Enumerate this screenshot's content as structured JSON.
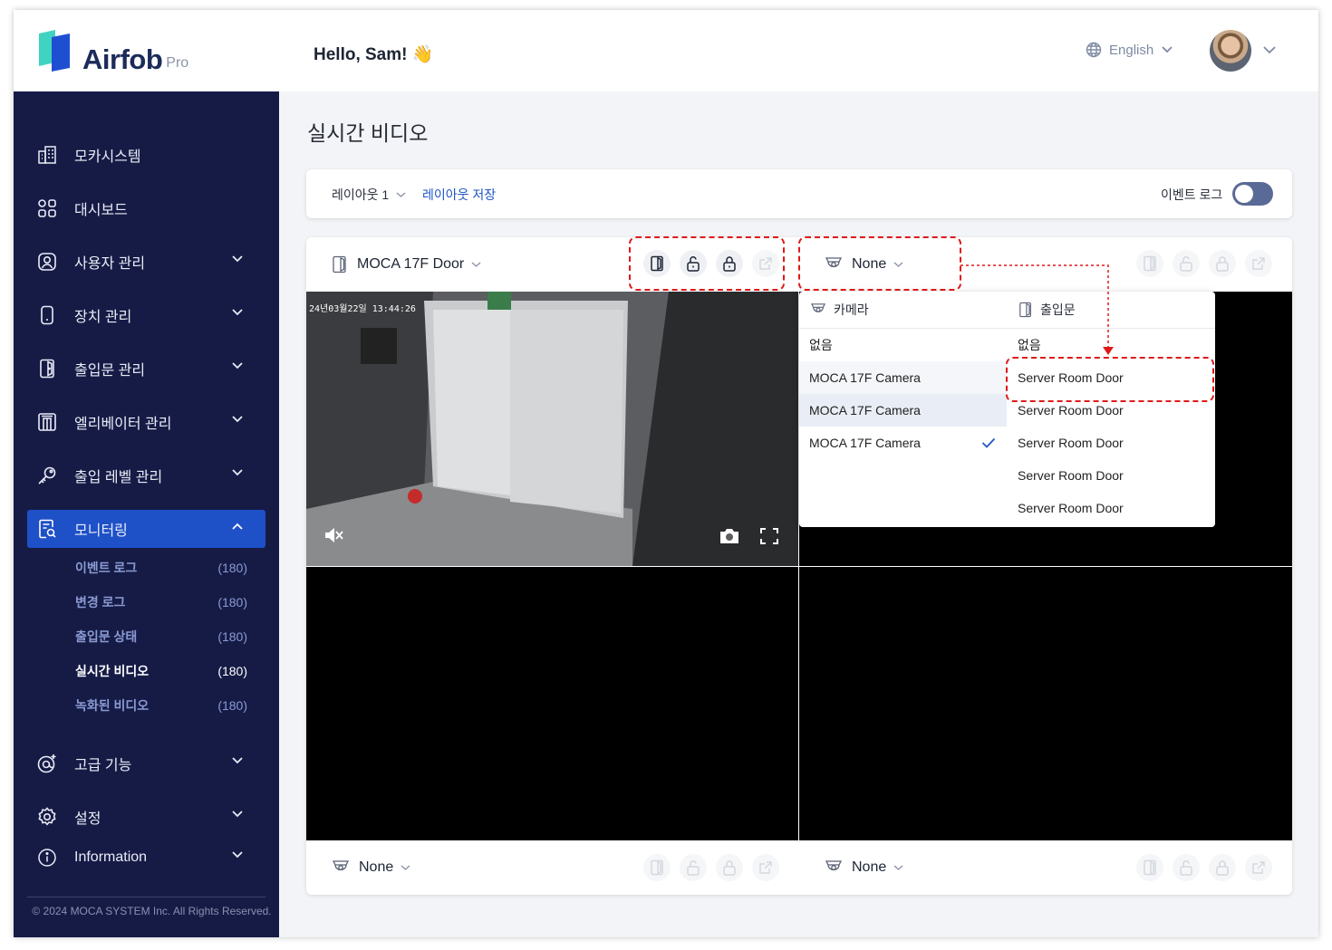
{
  "header": {
    "brand": "Airfob",
    "brand_suffix": "Pro",
    "greeting": "Hello, Sam! 👋",
    "language": "English"
  },
  "sidebar": {
    "items": [
      {
        "label": "모카시스템",
        "icon": "building-icon"
      },
      {
        "label": "대시보드",
        "icon": "dashboard-icon"
      },
      {
        "label": "사용자 관리",
        "icon": "user-icon"
      },
      {
        "label": "장치 관리",
        "icon": "device-icon"
      },
      {
        "label": "출입문 관리",
        "icon": "door-icon"
      },
      {
        "label": "엘리베이터 관리",
        "icon": "elevator-icon"
      },
      {
        "label": "출입 레벨 관리",
        "icon": "key-icon"
      },
      {
        "label": "모니터링",
        "icon": "monitoring-icon"
      },
      {
        "label": "고급 기능",
        "icon": "advanced-icon"
      },
      {
        "label": "설정",
        "icon": "gear-icon"
      },
      {
        "label": "Information",
        "icon": "info-icon"
      }
    ],
    "sub_items": [
      {
        "label": "이벤트 로그",
        "count": "(180)"
      },
      {
        "label": "변경 로그",
        "count": "(180)"
      },
      {
        "label": "출입문 상태",
        "count": "(180)"
      },
      {
        "label": "실시간 비디오",
        "count": "(180)"
      },
      {
        "label": "녹화된 비디오",
        "count": "(180)"
      }
    ],
    "copyright": "© 2024 MOCA SYSTEM Inc. All Rights Reserved."
  },
  "main": {
    "title": "실시간 비디오",
    "layout_label": "레이아웃 1",
    "layout_save": "레이아웃 저장",
    "event_log_label": "이벤트 로그",
    "event_log_enabled": false,
    "cells": [
      {
        "title": "MOCA 17F Door",
        "timestamp": "24년03월22일 13:44:26"
      },
      {
        "title": "None"
      },
      {
        "title": "None"
      },
      {
        "title": "None"
      }
    ],
    "dropdown": {
      "camera_header": "카메라",
      "door_header": "출입문",
      "camera_options": [
        "없음",
        "MOCA 17F Camera",
        "MOCA 17F Camera",
        "MOCA 17F Camera"
      ],
      "door_options": [
        "없음",
        "Server Room Door",
        "Server Room Door",
        "Server Room Door",
        "Server Room Door",
        "Server Room Door"
      ]
    }
  },
  "colors": {
    "sidebar_bg": "#161b46",
    "active_nav": "#1e50c8",
    "link": "#1d55c4",
    "annotation": "#e01818"
  }
}
